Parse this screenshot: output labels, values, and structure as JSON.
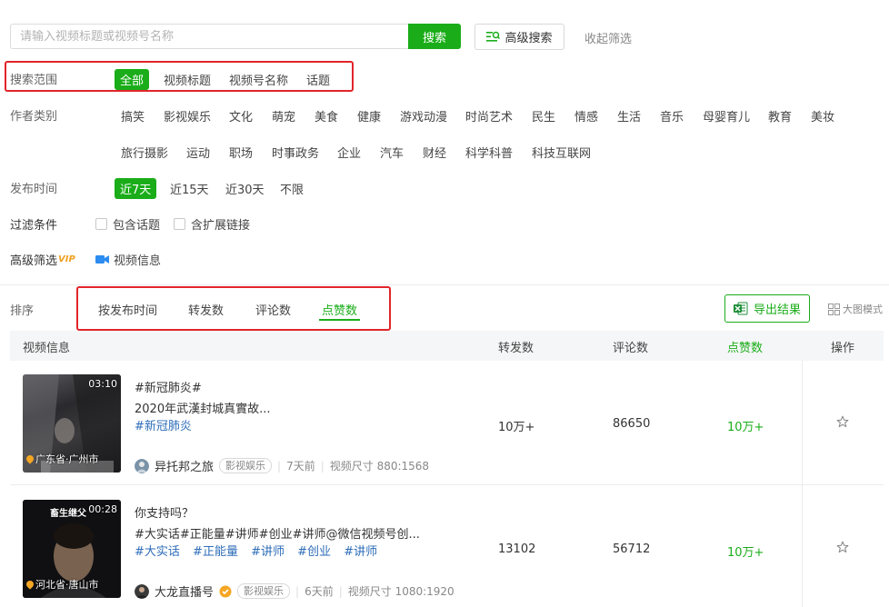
{
  "search": {
    "placeholder": "请输入视频标题或视频号名称",
    "button": "搜索",
    "advanced": "高级搜索",
    "collapse": "收起筛选"
  },
  "filters": {
    "scope": {
      "label": "搜索范围",
      "options": [
        "全部",
        "视频标题",
        "视频号名称",
        "话题"
      ],
      "active": 0
    },
    "category": {
      "label": "作者类别",
      "row1": [
        "搞笑",
        "影视娱乐",
        "文化",
        "萌宠",
        "美食",
        "健康",
        "游戏动漫",
        "时尚艺术",
        "民生",
        "情感",
        "生活",
        "音乐",
        "母婴育儿",
        "教育",
        "美妆"
      ],
      "row2": [
        "旅行摄影",
        "运动",
        "职场",
        "时事政务",
        "企业",
        "汽车",
        "财经",
        "科学科普",
        "科技互联网"
      ]
    },
    "time": {
      "label": "发布时间",
      "options": [
        "近7天",
        "近15天",
        "近30天",
        "不限"
      ],
      "active": 0
    },
    "conditions": {
      "label": "过滤条件",
      "options": [
        "包含话题",
        "含扩展链接"
      ]
    },
    "advanced": {
      "label": "高级筛选",
      "vip": "VIP",
      "video_info": "视频信息"
    }
  },
  "sort": {
    "label": "排序",
    "tabs": [
      "按发布时间",
      "转发数",
      "评论数",
      "点赞数"
    ],
    "active": 3,
    "export": "导出结果",
    "big_mode": "大图模式"
  },
  "table": {
    "headers": {
      "info": "视频信息",
      "shares": "转发数",
      "comments": "评论数",
      "likes": "点赞数",
      "action": "操作"
    },
    "rows": [
      {
        "duration": "03:10",
        "location": "广东省·广州市",
        "line1": "#新冠肺炎#",
        "line2": "2020年武漢封城真實故...",
        "tags": [
          "#新冠肺炎"
        ],
        "author": "异托邦之旅",
        "category": "影视娱乐",
        "time": "7天前",
        "size": "视频尺寸 880:1568",
        "shares": "10万+",
        "comments": "86650",
        "likes": "10万+"
      },
      {
        "duration": "00:28",
        "overlay": "畜生继父",
        "location": "河北省·唐山市",
        "line1": "你支持吗？",
        "line2": "#大实话#正能量#讲师#创业#讲师@微信视频号创...",
        "tags": [
          "#大实话",
          "#正能量",
          "#讲师",
          "#创业",
          "#讲师"
        ],
        "author": "大龙直播号",
        "category": "影视娱乐",
        "time": "6天前",
        "size": "视频尺寸 1080:1920",
        "shares": "13102",
        "comments": "56712",
        "likes": "10万+"
      }
    ]
  },
  "colors": {
    "accent": "#1aad19",
    "highlight_box": "#e1252a",
    "link": "#2e6db8"
  }
}
